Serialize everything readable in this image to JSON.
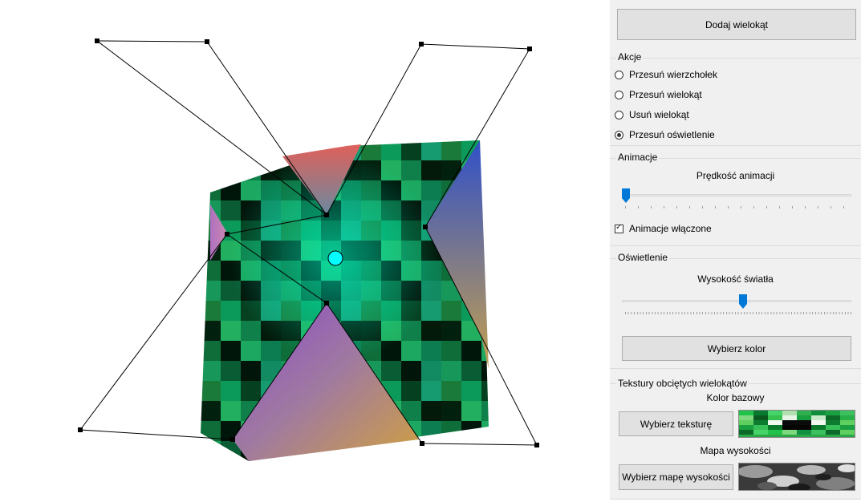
{
  "canvas": {
    "polygon_fill": "textured-green-tiles",
    "light_color": "#00ffff"
  },
  "panel": {
    "add_polygon_label": "Dodaj wielokąt",
    "actions": {
      "title": "Akcje",
      "options": [
        {
          "label": "Przesuń wierzchołek",
          "checked": false
        },
        {
          "label": "Przesuń wielokąt",
          "checked": false
        },
        {
          "label": "Usuń wielokąt",
          "checked": false
        },
        {
          "label": "Przesuń oświetlenie",
          "checked": true
        }
      ]
    },
    "animations": {
      "title": "Animacje",
      "speed_label": "Prędkość animacji",
      "speed_value": 0,
      "enabled_label": "Animacje włączone",
      "enabled": true
    },
    "lighting": {
      "title": "Oświetlenie",
      "height_label": "Wysokość światła",
      "height_value": 0.53,
      "choose_color_label": "Wybierz kolor"
    },
    "textures": {
      "title": "Tekstury obciętych wielokątów",
      "base_color_label": "Kolor bazowy",
      "choose_texture_label": "Wybierz teksturę",
      "height_map_label": "Mapa wysokości",
      "choose_height_map_label": "Wybierz mapę wysokości"
    }
  },
  "colors": {
    "accent": "#0078d7",
    "panel_bg": "#f0f0f0",
    "button_bg": "#e1e1e1"
  }
}
